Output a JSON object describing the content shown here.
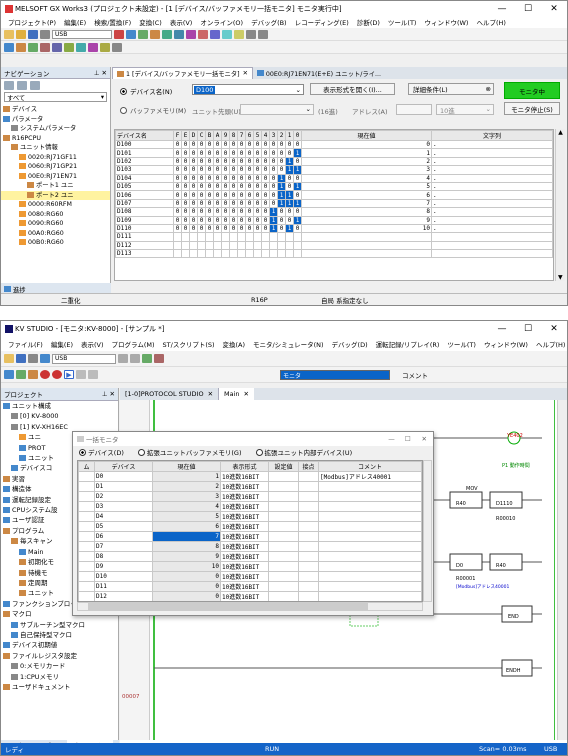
{
  "gx": {
    "title": "MELSOFT GX Works3 (プロジェクト未設定) - [1 [デバイス/バッファメモリ一括モニタ] モニタ実行中]",
    "menu": [
      "プロジェクト(P)",
      "編集(E)",
      "検索/置換(F)",
      "変換(C)",
      "表示(V)",
      "オンライン(O)",
      "デバッグ(B)",
      "レコーディング(E)",
      "診断(D)",
      "ツール(T)",
      "ウィンドウ(W)",
      "ヘルプ(H)"
    ],
    "toolbar_combo": "USB",
    "nav_title": "ナビゲーション",
    "nav_filter": "すべて",
    "tree": [
      "デバイス",
      "パラメータ",
      "システムパラメータ",
      "R16PCPU",
      "ユニット情報",
      "0020:RJ71GF11",
      "0060:RJ71GP21",
      "00E0:RJ71EN71",
      "ポート1 ユニ",
      "ポート2 ユニ",
      "0000:R60RFM",
      "0080:RG60",
      "0090:RG60",
      "00A0:RG60",
      "00B0:RG60"
    ],
    "tab1": "1 [デバイス/バッファメモリ一括モニタ]",
    "tab2": "00E0:RJ71EN71(E+E) ユニット/ライ...",
    "radio_device": "デバイス名(N)",
    "device_value": "D100",
    "format_button": "表示形式を開く(I)...",
    "detail_button": "詳細条件(L)",
    "monitor_button": "モニタ中",
    "radio_buffer": "バッファメモリ(M)",
    "unit_label": "ユニット先頭(U)",
    "hex_label": "(16進)",
    "address_label": "アドレス(A)",
    "address_unit": "10進",
    "stop_button": "モニタ停止(S)",
    "col_device": "デバイス名",
    "bit_headers": [
      "F",
      "E",
      "D",
      "C",
      "B",
      "A",
      "9",
      "8",
      "7",
      "6",
      "5",
      "4",
      "3",
      "2",
      "1",
      "0"
    ],
    "col_value": "現在値",
    "col_string": "文字列",
    "rows": [
      {
        "d": "D100",
        "bits": "0000000000000000",
        "v": "0"
      },
      {
        "d": "D101",
        "bits": "0000000000000001",
        "v": "1"
      },
      {
        "d": "D102",
        "bits": "0000000000000010",
        "v": "2"
      },
      {
        "d": "D103",
        "bits": "0000000000000011",
        "v": "3"
      },
      {
        "d": "D104",
        "bits": "0000000000000100",
        "v": "4"
      },
      {
        "d": "D105",
        "bits": "0000000000000101",
        "v": "5"
      },
      {
        "d": "D106",
        "bits": "0000000000000110",
        "v": "6"
      },
      {
        "d": "D107",
        "bits": "0000000000000111",
        "v": "7"
      },
      {
        "d": "D108",
        "bits": "0000000000001000",
        "v": "8"
      },
      {
        "d": "D109",
        "bits": "0000000000001001",
        "v": "9"
      },
      {
        "d": "D110",
        "bits": "0000000000001010",
        "v": "10"
      },
      {
        "d": "D111",
        "bits": "",
        "v": ""
      },
      {
        "d": "D112",
        "bits": "",
        "v": ""
      },
      {
        "d": "D113",
        "bits": "",
        "v": ""
      }
    ],
    "status_left": "進捗",
    "status_items": [
      "二重化",
      "R16P",
      "自局 系指定なし"
    ]
  },
  "kv": {
    "title": "KV STUDIO - [モニタ:KV-8000] - [サンプル *]",
    "menu": [
      "ファイル(F)",
      "編集(E)",
      "表示(V)",
      "プログラム(M)",
      "ST/スクリプト(S)",
      "変換(A)",
      "モニタ/シミュレータ(N)",
      "デバッグ(D)",
      "運転記録/リプレイ(R)",
      "ツール(T)",
      "ウィンドウ(W)",
      "ヘルプ(H)"
    ],
    "toolbar_combo": "USB",
    "mode_combo": "モニタ",
    "comment_label": "コメント",
    "project_title": "プロジェクト",
    "tab_protocol": "[1-0]PROTOCOL STUDIO",
    "tab_main": "Main",
    "tree": [
      "ユニット構成",
      "[0] KV-8000",
      "[1] KV-XH16EC",
      "ユニ",
      "PROT",
      "ユニット",
      "デバイスコ",
      "実習",
      "構造体",
      "運転記録設定",
      "CPUシステム設",
      "ユーザ認証",
      "プログラム",
      "毎スキャン",
      "Main",
      "初期化モ",
      "待機モ",
      "定周期",
      "ユニット",
      "ファンクションブロック",
      "マクロ",
      "サブルーチン型マクロ",
      "自己保持型マクロ",
      "デバイス初期値",
      "ファイルレジスタ設定",
      "0:メモリカード",
      "1:CPUメモリ",
      "ユーザドキュメント"
    ],
    "bottom_tabs": [
      "モニタ",
      "ライブラリ",
      "プロジェクト"
    ],
    "dialog_title": "一括モニタ",
    "radio_device": "デバイス(D)",
    "radio_buffer": "拡張ユニットバッファメモリ(G)",
    "radio_internal": "拡張ユニット内部デバイス(U)",
    "headers": [
      "ム",
      "デバイス",
      "現在値",
      "表示形式",
      "設定値",
      "接点",
      "コメント"
    ],
    "rows": [
      {
        "d": "D0",
        "v": "1",
        "f": "10進数16BIT",
        "c": "[Modbus]アドレス40001"
      },
      {
        "d": "D1",
        "v": "2",
        "f": "10進数16BIT",
        "c": ""
      },
      {
        "d": "D2",
        "v": "3",
        "f": "10進数16BIT",
        "c": ""
      },
      {
        "d": "D3",
        "v": "4",
        "f": "10進数16BIT",
        "c": ""
      },
      {
        "d": "D4",
        "v": "5",
        "f": "10進数16BIT",
        "c": ""
      },
      {
        "d": "D5",
        "v": "6",
        "f": "10進数16BIT",
        "c": ""
      },
      {
        "d": "D6",
        "v": "7",
        "f": "10進数16BIT",
        "c": ""
      },
      {
        "d": "D7",
        "v": "8",
        "f": "10進数16BIT",
        "c": ""
      },
      {
        "d": "D8",
        "v": "9",
        "f": "10進数16BIT",
        "c": ""
      },
      {
        "d": "D9",
        "v": "10",
        "f": "10進数16BIT",
        "c": ""
      },
      {
        "d": "D10",
        "v": "0",
        "f": "10進数16BIT",
        "c": ""
      },
      {
        "d": "D11",
        "v": "0",
        "f": "10進数16BIT",
        "c": ""
      },
      {
        "d": "D12",
        "v": "0",
        "f": "10進数16BIT",
        "c": ""
      }
    ],
    "ladder": [
      "YE402",
      "P1 動作時間",
      "MOV",
      "R40",
      "D1110",
      "R00010",
      "D0",
      "R40",
      "R00001",
      "[Modbus]アドレス40001",
      "END",
      "ENDH"
    ],
    "line_numbers": [
      "00007",
      "00008"
    ],
    "status_left": "レディ",
    "status_run": "RUN",
    "status_scan": "Scan= 0.03ms",
    "status_usb": "USB"
  },
  "colors": {
    "accent": "#0000ff",
    "monitor_green": "#22cc22",
    "highlight": "#0a64c8"
  }
}
